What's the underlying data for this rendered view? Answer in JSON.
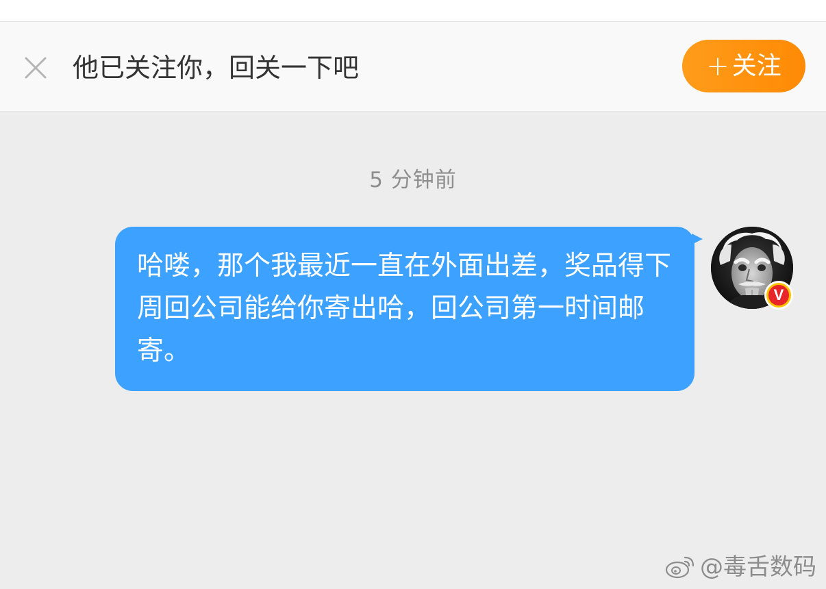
{
  "banner": {
    "message": "他已关注你，回关一下吧",
    "follow_plus": "+",
    "follow_label": "关注"
  },
  "chat": {
    "timestamp": "5 分钟前",
    "messages": [
      {
        "text": "哈喽，那个我最近一直在外面出差，奖品得下周回公司能给你寄出哈，回公司第一时间邮寄。",
        "sender": "self"
      }
    ]
  },
  "avatar": {
    "badge": "V"
  },
  "watermark": {
    "handle": "@毒舌数码"
  },
  "colors": {
    "bubble": "#3da2ff",
    "follow_button": "#ff9c1a",
    "background": "#ededed",
    "badge": "#ffc300"
  }
}
